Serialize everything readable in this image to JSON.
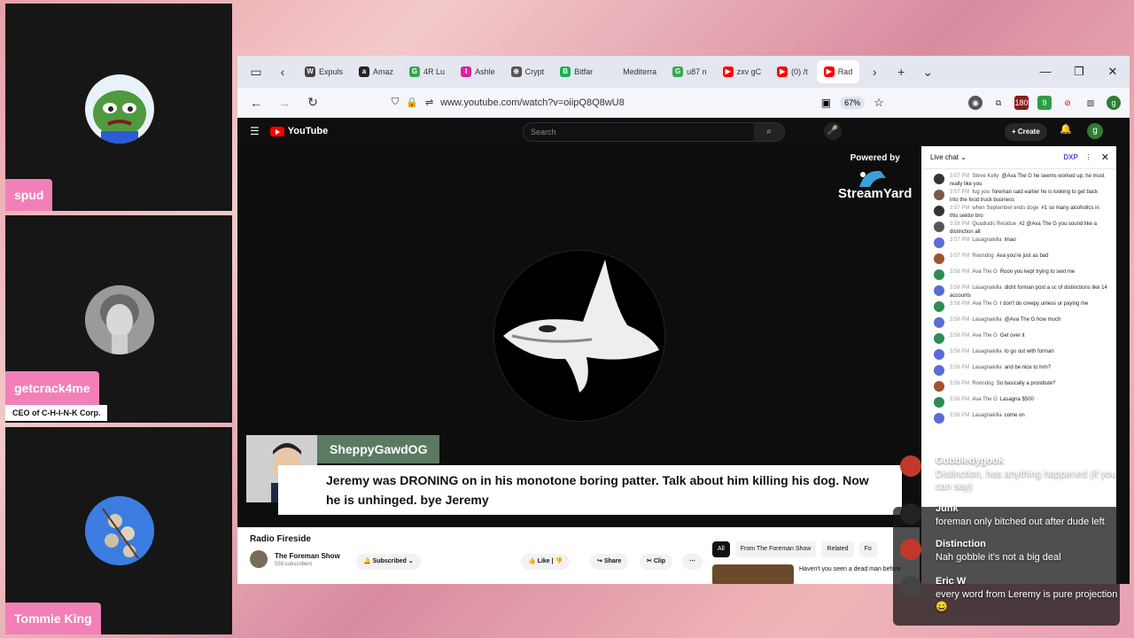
{
  "participants": [
    {
      "name": "spud",
      "subtitle": ""
    },
    {
      "name": "getcrack4me",
      "subtitle": "CEO of C-H-I-N-K Corp."
    },
    {
      "name": "Tommie King",
      "subtitle": ""
    }
  ],
  "browser": {
    "tabs": [
      {
        "label": "Expuls",
        "icon": "W",
        "color": "#444"
      },
      {
        "label": "Amaz",
        "icon": "a",
        "color": "#222"
      },
      {
        "label": "4R Lu",
        "icon": "G",
        "color": "#34a853"
      },
      {
        "label": "Ashle",
        "icon": "I",
        "color": "#d6249f"
      },
      {
        "label": "Crypt",
        "icon": "⊕",
        "color": "#555"
      },
      {
        "label": "Bitfar",
        "icon": "B",
        "color": "#16b157"
      },
      {
        "label": "Mediterra",
        "icon": "",
        "color": "#e4e6f0"
      },
      {
        "label": "u87 n",
        "icon": "G",
        "color": "#34a853"
      },
      {
        "label": "zxv gC",
        "icon": "▶",
        "color": "#f00"
      },
      {
        "label": "(0) /t",
        "icon": "▶",
        "color": "#f00"
      },
      {
        "label": "Rad",
        "icon": "▶",
        "color": "#f00"
      }
    ],
    "url": "www.youtube.com/watch?v=oiipQ8Q8wU8",
    "zoom": "67%",
    "ext_badges": [
      "180",
      "9"
    ]
  },
  "youtube": {
    "logo": "YouTube",
    "search_placeholder": "Search",
    "create_label": "+ Create",
    "avatar_letter": "g",
    "powered_by": "Powered by",
    "streamyard": "StreamYard",
    "lower_third_user": "SheppyGawdOG",
    "lower_third_text": "Jeremy was DRONING on in his monotone boring patter. Talk about him killing his dog. Now he is unhinged. bye Jeremy",
    "video_title": "Radio Fireside",
    "channel_name": "The Foreman Show",
    "channel_subs": "559 subscribers",
    "subscribed_label": "Subscribed",
    "like_label": "Like",
    "share_label": "Share",
    "clip_label": "Clip",
    "chips": [
      "All",
      "From The Foreman Show",
      "Related",
      "Fo"
    ],
    "rec_title": "Haven't you seen a dead man before"
  },
  "live_chat": {
    "title": "Live chat",
    "badge": "DXP",
    "messages": [
      {
        "time": "3:57 PM",
        "author": "Steve Kelly",
        "text": "@Ava The G he seems worked up, he must really like you",
        "color": "#333"
      },
      {
        "time": "3:57 PM",
        "author": "fug you",
        "text": "foreman said earlier he is looking to get back into the food truck business",
        "color": "#7a5a4a"
      },
      {
        "time": "3:57 PM",
        "author": "when September ends doge",
        "text": "#1 so many alcoholics in this sektor bro",
        "color": "#333"
      },
      {
        "time": "3:58 PM",
        "author": "Quadratic Residue",
        "text": "#2 @Ava The G you sound like a distinction alt",
        "color": "#555"
      },
      {
        "time": "3:57 PM",
        "author": "Lasagnakilla",
        "text": "lmao",
        "color": "#5b6bd8"
      },
      {
        "time": "3:57 PM",
        "author": "Roondog",
        "text": "Ava you're just as bad",
        "color": "#a0522d"
      },
      {
        "time": "3:58 PM",
        "author": "Ava The G",
        "text": "Roon you kept trying to sext me",
        "color": "#2e8b57"
      },
      {
        "time": "3:58 PM",
        "author": "Lasagnakilla",
        "text": "didnt forman post a sc of distinctions like 14 accounts",
        "color": "#5b6bd8"
      },
      {
        "time": "3:58 PM",
        "author": "Ava The G",
        "text": "I don't do creepy unless ur paying me",
        "color": "#2e8b57"
      },
      {
        "time": "3:58 PM",
        "author": "Lasagnakilla",
        "text": "@Ava The G how much",
        "color": "#5b6bd8"
      },
      {
        "time": "3:58 PM",
        "author": "Ava The G",
        "text": "Get over it",
        "color": "#2e8b57"
      },
      {
        "time": "3:58 PM",
        "author": "Lasagnakilla",
        "text": "to go out with forman",
        "color": "#5b6bd8"
      },
      {
        "time": "3:58 PM",
        "author": "Lasagnakilla",
        "text": "and be nice to him?",
        "color": "#5b6bd8"
      },
      {
        "time": "3:58 PM",
        "author": "Roondog",
        "text": "So basically a prostitute?",
        "color": "#a0522d"
      },
      {
        "time": "3:58 PM",
        "author": "Ava The G",
        "text": "Lasagna $500",
        "color": "#2e8b57"
      },
      {
        "time": "3:58 PM",
        "author": "Lasagnakilla",
        "text": "come on",
        "color": "#5b6bd8"
      }
    ]
  },
  "overlay": [
    {
      "name": "Gobbledygook",
      "text": "Distinction, has anything happened (if you can say)",
      "color": "#c0392b"
    },
    {
      "name": "Junk",
      "text": "foreman only bitched out after dude left",
      "color": "#222"
    },
    {
      "name": "Distinction",
      "text": "Nah gobble it's not a big deal",
      "color": "#c0392b"
    },
    {
      "name": "Eric W",
      "text": "every word from Leremy is pure projection 😄",
      "color": "#444"
    }
  ]
}
